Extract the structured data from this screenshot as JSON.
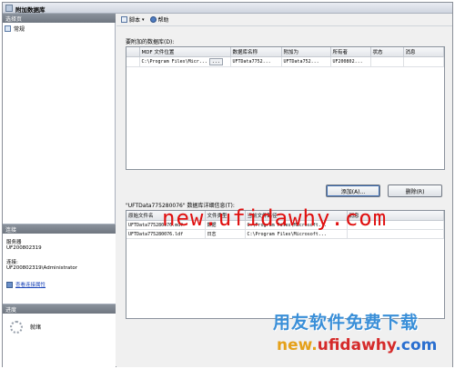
{
  "window": {
    "title": "附加数据库"
  },
  "left": {
    "pages_header": "选择页",
    "pages": [
      {
        "label": "常规"
      }
    ],
    "connection_header": "连接",
    "server_label": "服务器",
    "server_value": "UF200802319",
    "connection_label": "连接:",
    "connection_value": "UF200802319\\Administrator",
    "view_props_link": "查看连接属性",
    "progress_header": "进度",
    "progress_status": "就绪"
  },
  "toolbar": {
    "script_label": "脚本",
    "help_label": "帮助"
  },
  "attach": {
    "section_label": "要附加的数据库(D):",
    "columns": [
      "",
      "MDF 文件位置",
      "数据库名称",
      "附加为",
      "所有者",
      "状态",
      "消息"
    ],
    "rows": [
      {
        "mdf": "C:\\Program Files\\Micr...",
        "browse": "...",
        "dbname": "UFTData7752...",
        "attach_as": "UFTData752...",
        "owner": "UF200802...",
        "status": "",
        "message": ""
      }
    ]
  },
  "buttons": {
    "add": "添加(A)...",
    "remove": "删除(R)"
  },
  "details": {
    "section_label": "\"UFTData775280076\" 数据库详细信息(T):",
    "columns": [
      "原始文件名",
      "文件类型",
      "当前文件路径",
      "消息"
    ],
    "rows": [
      {
        "filename": "UFTData775280076.mdf",
        "type": "数据",
        "path": "C:\\Program Files\\Microsoft...",
        "message": ""
      },
      {
        "filename": "UFTData775280076.ldf",
        "type": "日志",
        "path": "C:\\Program Files\\Microsoft...",
        "message": ""
      }
    ]
  },
  "watermark": {
    "url_red": "new.ufidawhy.com",
    "brand_cn": "用友软件免费下载",
    "url_part1": "new.",
    "url_part2": "ufidawhy",
    "url_part3": ".com"
  },
  "colors": {
    "accent": "#3f6fb3",
    "watermark_red": "#e01010",
    "watermark_blue": "#3a8fd8"
  }
}
